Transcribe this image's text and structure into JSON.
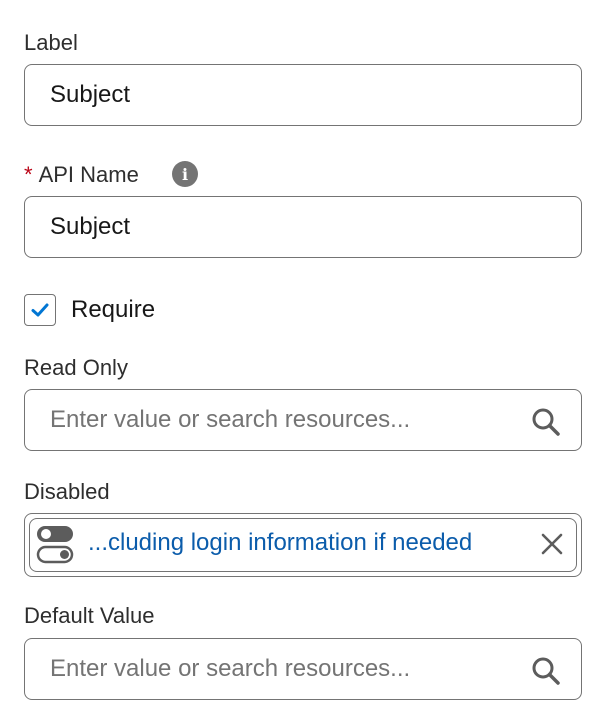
{
  "fields": {
    "label": {
      "label": "Label",
      "value": "Subject"
    },
    "api_name": {
      "required_mark": "*",
      "label": "API Name",
      "value": "Subject"
    },
    "require": {
      "label": "Require",
      "checked": true
    },
    "read_only": {
      "label": "Read Only",
      "placeholder": "Enter value or search resources..."
    },
    "disabled": {
      "label": "Disabled",
      "pill_text": "...cluding login information if needed"
    },
    "default_value": {
      "label": "Default Value",
      "placeholder": "Enter value or search resources..."
    }
  },
  "icons": {
    "info": "info-icon",
    "search": "search-icon",
    "toggle": "toggle-icon",
    "close": "close-icon",
    "check": "checkmark-icon"
  },
  "colors": {
    "required": "#ba0517",
    "pill_text": "#0b5cab",
    "check": "#0176d3",
    "border": "#747474"
  }
}
